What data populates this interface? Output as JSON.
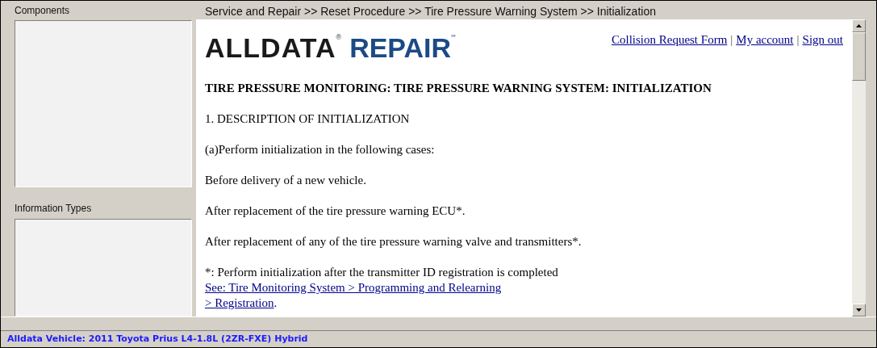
{
  "left_panel": {
    "sections": [
      {
        "label": "Components"
      },
      {
        "label": "Information Types"
      }
    ]
  },
  "breadcrumb": "Service and Repair >> Reset Procedure >> Tire Pressure Warning System >> Initialization",
  "logo": {
    "brand": "ALLDATA",
    "brand_mark": "®",
    "product": "REPAIR",
    "product_mark": "℠"
  },
  "header_links": [
    {
      "label": "Collision Request Form"
    },
    {
      "label": "My account"
    },
    {
      "label": "Sign out"
    }
  ],
  "header_separator": "|",
  "content": [
    {
      "kind": "heading",
      "text": "TIRE PRESSURE MONITORING: TIRE PRESSURE WARNING SYSTEM: INITIALIZATION"
    },
    {
      "kind": "paragraph",
      "text": "1. DESCRIPTION OF INITIALIZATION"
    },
    {
      "kind": "paragraph",
      "text": "(a)Perform initialization in the following cases:"
    },
    {
      "kind": "paragraph",
      "text": "Before delivery of a new vehicle."
    },
    {
      "kind": "paragraph",
      "text": "After replacement of the tire pressure warning ECU*."
    },
    {
      "kind": "paragraph",
      "text": "After replacement of any of the tire pressure warning valve and transmitters*."
    },
    {
      "kind": "note",
      "text": "*: Perform initialization after the transmitter ID registration is completed",
      "link_lines": [
        "See: Tire Monitoring System > Programming and Relearning",
        "> Registration"
      ],
      "after": "."
    }
  ],
  "status_bar": "Alldata Vehicle: 2011 Toyota Prius L4-1.8L (2ZR-FXE) Hybrid"
}
